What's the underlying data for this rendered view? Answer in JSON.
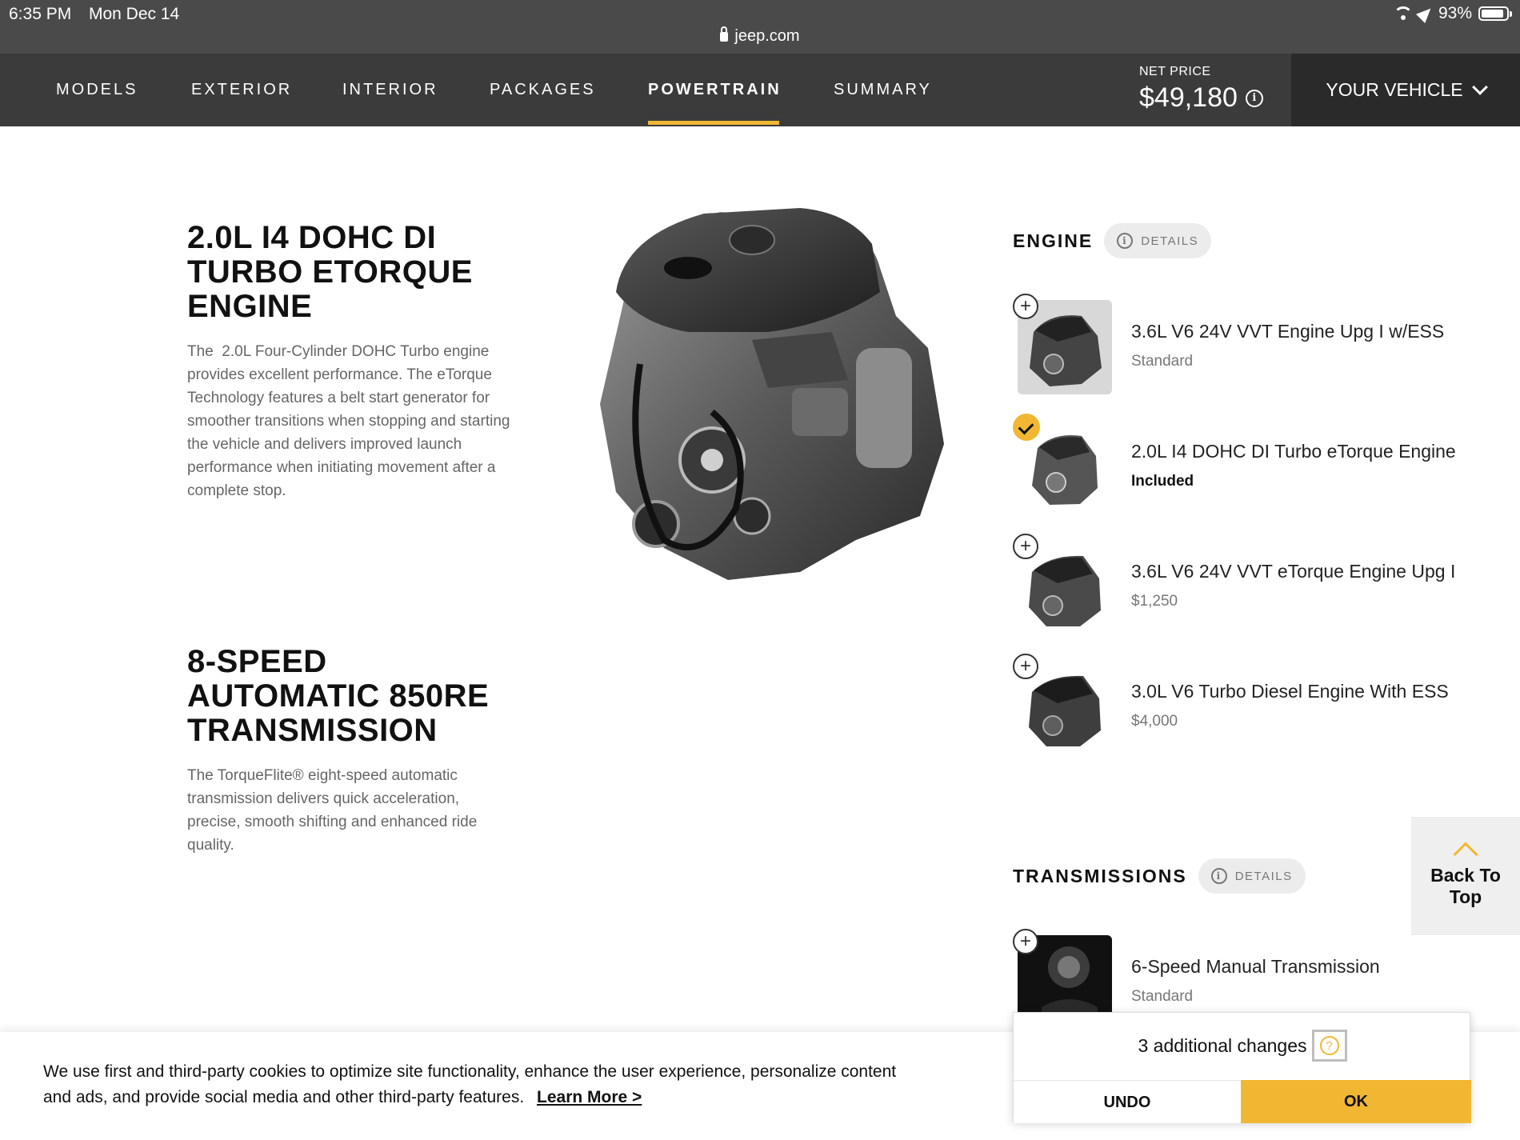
{
  "status": {
    "time": "6:35 PM",
    "date": "Mon Dec 14",
    "battery": "93%",
    "url": "jeep.com"
  },
  "nav": {
    "tabs": [
      "MODELS",
      "EXTERIOR",
      "INTERIOR",
      "PACKAGES",
      "POWERTRAIN",
      "SUMMARY"
    ],
    "active_tab": "POWERTRAIN",
    "net_price_label": "NET PRICE",
    "net_price": "$49,180",
    "your_vehicle": "YOUR VEHICLE"
  },
  "features": [
    {
      "title_lines": [
        "2.0L I4 DOHC DI",
        "TURBO ETORQUE",
        "ENGINE"
      ],
      "description": "The  2.0L Four-Cylinder DOHC Turbo engine provides excellent performance. The eTorque Technology features a belt start generator for smoother transitions when stopping and starting the vehicle and delivers improved launch performance when initiating movement after a complete stop."
    },
    {
      "title_lines": [
        "8-SPEED",
        "AUTOMATIC 850RE",
        "TRANSMISSION"
      ],
      "description": "The TorqueFlite® eight-speed automatic transmission delivers quick acceleration, precise, smooth shifting and enhanced ride quality."
    }
  ],
  "engine_section": {
    "heading": "ENGINE",
    "details_label": "DETAILS",
    "options": [
      {
        "name": "3.6L V6 24V VVT Engine Upg I w/ESS",
        "price": "Standard",
        "selected": false
      },
      {
        "name": "2.0L I4 DOHC DI Turbo eTorque Engine",
        "price": "Included",
        "selected": true
      },
      {
        "name": "3.6L V6 24V VVT eTorque Engine Upg I",
        "price": "$1,250",
        "selected": false
      },
      {
        "name": "3.0L V6 Turbo Diesel Engine With ESS",
        "price": "$4,000",
        "selected": false
      }
    ]
  },
  "transmission_section": {
    "heading": "TRANSMISSIONS",
    "details_label": "DETAILS",
    "options": [
      {
        "name": "6-Speed Manual Transmission",
        "price": "Standard",
        "selected": false
      }
    ]
  },
  "back_to_top": {
    "line1": "Back To",
    "line2": "Top"
  },
  "cookie": {
    "text": "We use first and third-party cookies to optimize site functionality, enhance the user experience, personalize content and ads, and provide social media and other third-party features.",
    "link": "Learn More >"
  },
  "changes_popup": {
    "message": "3 additional changes",
    "undo": "UNDO",
    "ok": "OK"
  },
  "colors": {
    "accent": "#f2b732",
    "nav_bg": "#3b3b3b",
    "status_bg": "#4a4a4a"
  }
}
